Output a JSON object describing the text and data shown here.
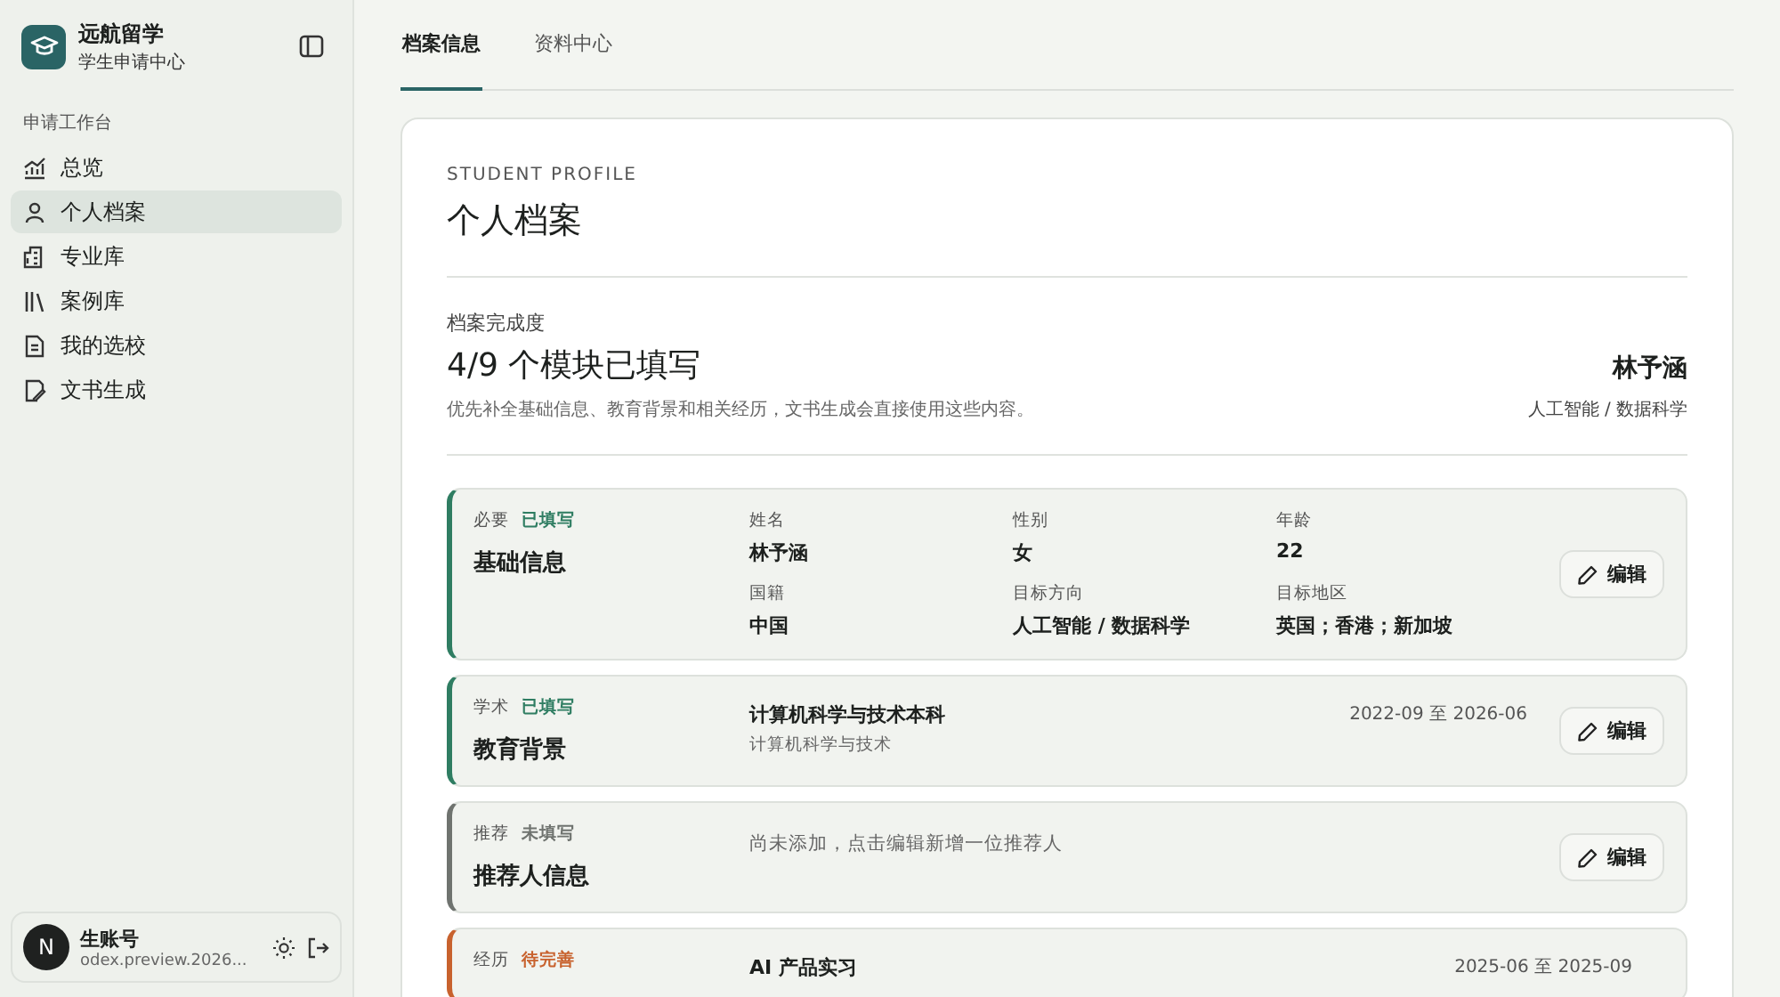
{
  "sidebar": {
    "brand": {
      "name": "远航留学",
      "subtitle": "学生申请中心"
    },
    "section_label": "申请工作台",
    "items": [
      {
        "label": "总览",
        "selected": false
      },
      {
        "label": "个人档案",
        "selected": true
      },
      {
        "label": "专业库",
        "selected": false
      },
      {
        "label": "案例库",
        "selected": false
      },
      {
        "label": "我的选校",
        "selected": false
      },
      {
        "label": "文书生成",
        "selected": false
      }
    ],
    "account": {
      "avatar": "N",
      "name": "生账号",
      "email": "odex.preview.2026..."
    }
  },
  "tabs": [
    {
      "label": "档案信息",
      "selected": true
    },
    {
      "label": "资料中心",
      "selected": false
    }
  ],
  "profile": {
    "eyebrow": "STUDENT PROFILE",
    "title": "个人档案",
    "progress_label": "档案完成度",
    "progress": "4/9 个模块已填写",
    "hint": "优先补全基础信息、教育背景和相关经历，文书生成会直接使用这些内容。",
    "student_name": "林予涵",
    "student_direction": "人工智能 / 数据科学"
  },
  "sections": [
    {
      "kind": "fields",
      "category": "必要",
      "status": "已填写",
      "color": "#2f7d62",
      "title": "基础信息",
      "fields": [
        {
          "label": "姓名",
          "value": "林予涵"
        },
        {
          "label": "性别",
          "value": "女"
        },
        {
          "label": "年龄",
          "value": "22"
        },
        {
          "label": "国籍",
          "value": "中国"
        },
        {
          "label": "目标方向",
          "value": "人工智能 / 数据科学"
        },
        {
          "label": "目标地区",
          "value": "英国；香港；新加坡"
        }
      ],
      "button": "编辑"
    },
    {
      "kind": "entry",
      "category": "学术",
      "status": "已填写",
      "color": "#2f7d62",
      "title": "教育背景",
      "entry_title": "计算机科学与技术本科",
      "entry_subtitle": "计算机科学与技术",
      "date": "2022-09 至 2026-06",
      "button": "编辑"
    },
    {
      "kind": "empty",
      "category": "推荐",
      "status": "未填写",
      "color": "#6f736f",
      "title": "推荐人信息",
      "note": "尚未添加，点击编辑新增一位推荐人",
      "button": "编辑"
    },
    {
      "kind": "entry",
      "category": "经历",
      "status": "待完善",
      "color": "#c8622e",
      "entry_title": "AI 产品实习",
      "date": "2025-06 至 2025-09"
    }
  ]
}
